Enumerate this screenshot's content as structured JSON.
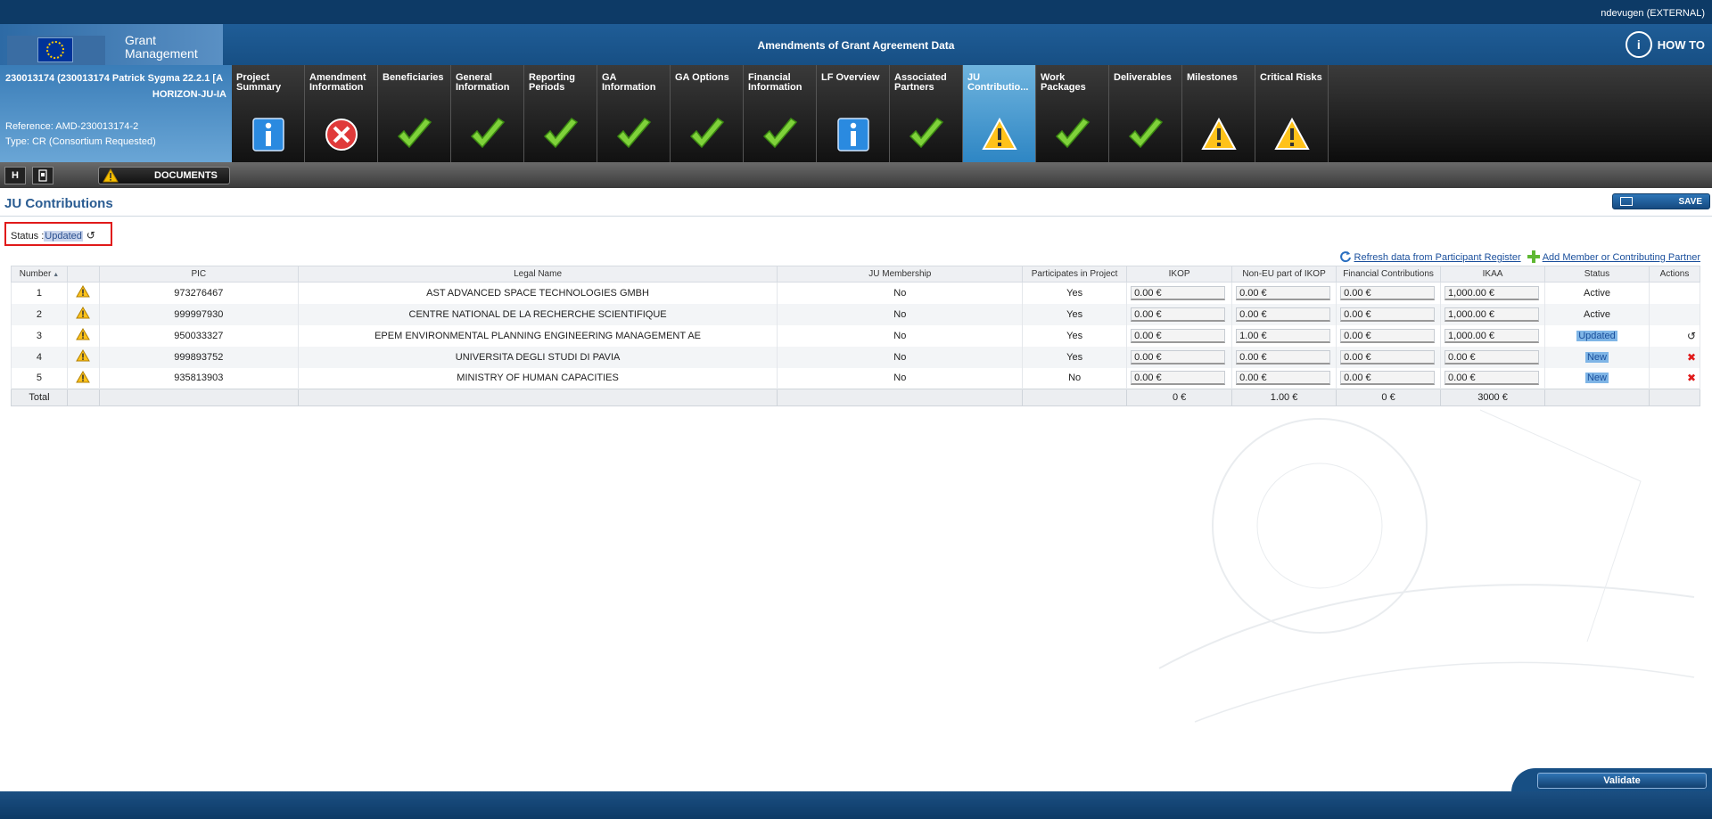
{
  "user": {
    "name": "ndevugen (EXTERNAL)"
  },
  "header": {
    "logo_text_1": "Grant",
    "logo_text_2": "Management",
    "title": "Amendments of Grant Agreement Data",
    "howto": "HOW TO"
  },
  "project": {
    "line1": "230013174 (230013174 Patrick Sygma 22.2.1 [A",
    "line2": "HORIZON-JU-IA",
    "reference": "Reference: AMD-230013174-2",
    "type": "Type: CR (Consortium Requested)"
  },
  "tabs": [
    {
      "label": "Project Summary",
      "icon": "info-icon"
    },
    {
      "label": "Amendment Information",
      "icon": "error-icon"
    },
    {
      "label": "Beneficiaries",
      "icon": "check-icon"
    },
    {
      "label": "General Information",
      "icon": "check-icon"
    },
    {
      "label": "Reporting Periods",
      "icon": "check-icon"
    },
    {
      "label": "GA Information",
      "icon": "check-icon"
    },
    {
      "label": "GA Options",
      "icon": "check-icon"
    },
    {
      "label": "Financial Information",
      "icon": "check-icon"
    },
    {
      "label": "LF Overview",
      "icon": "info-icon"
    },
    {
      "label": "Associated Partners",
      "icon": "check-icon"
    },
    {
      "label": "JU Contributio...",
      "icon": "warning-icon",
      "active": true
    },
    {
      "label": "Work Packages",
      "icon": "check-icon"
    },
    {
      "label": "Deliverables",
      "icon": "check-icon"
    },
    {
      "label": "Milestones",
      "icon": "warning-icon"
    },
    {
      "label": "Critical Risks",
      "icon": "warning-icon"
    }
  ],
  "toolbar": {
    "btn1": "H",
    "documents": "DOCUMENTS"
  },
  "page": {
    "title": "JU Contributions",
    "save": "SAVE",
    "status_label": "Status :",
    "status_value": "Updated",
    "refresh_link": "Refresh data from Participant Register",
    "add_link": "Add Member or Contributing Partner"
  },
  "table": {
    "headers": [
      "Number",
      "",
      "PIC",
      "Legal Name",
      "JU Membership",
      "Participates in Project",
      "IKOP",
      "Non-EU part of IKOP",
      "Financial Contributions",
      "IKAA",
      "Status",
      "Actions"
    ],
    "rows": [
      {
        "number": "1",
        "pic": "973276467",
        "name": "AST ADVANCED SPACE TECHNOLOGIES GMBH",
        "membership": "No",
        "participates": "Yes",
        "ikop": "0.00 €",
        "noneu": "0.00 €",
        "financial": "0.00 €",
        "ikaa": "1,000.00 €",
        "status": "Active",
        "action": ""
      },
      {
        "number": "2",
        "pic": "999997930",
        "name": "CENTRE NATIONAL DE LA RECHERCHE SCIENTIFIQUE",
        "membership": "No",
        "participates": "Yes",
        "ikop": "0.00 €",
        "noneu": "0.00 €",
        "financial": "0.00 €",
        "ikaa": "1,000.00 €",
        "status": "Active",
        "action": ""
      },
      {
        "number": "3",
        "pic": "950033327",
        "name": "EPEM ENVIRONMENTAL PLANNING ENGINEERING MANAGEMENT AE",
        "membership": "No",
        "participates": "Yes",
        "ikop": "0.00 €",
        "noneu": "1.00 €",
        "financial": "0.00 €",
        "ikaa": "1,000.00 €",
        "status": "Updated",
        "action": "undo"
      },
      {
        "number": "4",
        "pic": "999893752",
        "name": "UNIVERSITA DEGLI STUDI DI PAVIA",
        "membership": "No",
        "participates": "Yes",
        "ikop": "0.00 €",
        "noneu": "0.00 €",
        "financial": "0.00 €",
        "ikaa": "0.00 €",
        "status": "New",
        "action": "delete"
      },
      {
        "number": "5",
        "pic": "935813903",
        "name": "MINISTRY OF HUMAN CAPACITIES",
        "membership": "No",
        "participates": "No",
        "ikop": "0.00 €",
        "noneu": "0.00 €",
        "financial": "0.00 €",
        "ikaa": "0.00 €",
        "status": "New",
        "action": "delete"
      }
    ],
    "totals": {
      "label": "Total",
      "ikop": "0 €",
      "noneu": "1.00 €",
      "financial": "0 €",
      "ikaa": "3000 €"
    }
  },
  "footer": {
    "validate": "Validate"
  },
  "colors": {
    "accent": "#2a5c92",
    "header": "#174f84",
    "active_tab": "#2e86c4",
    "alert": "#e01a1a"
  }
}
